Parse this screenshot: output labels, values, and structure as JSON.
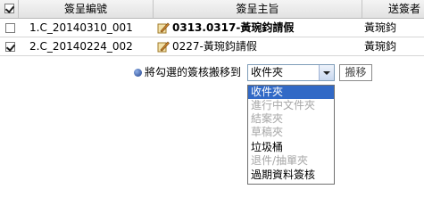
{
  "table": {
    "headers": {
      "id": "簽呈編號",
      "subject": "簽呈主旨",
      "sender": "送簽者"
    },
    "rows": [
      {
        "checked": false,
        "id": "1.C_20140310_001",
        "subject": "0313.0317-黃琬鈞請假",
        "sender": "黃琬鈞"
      },
      {
        "checked": true,
        "id": "2.C_20140224_002",
        "subject": "0227-黃琬鈞請假",
        "sender": "黃琬鈞"
      }
    ]
  },
  "move": {
    "label": "將勾選的簽核搬移到",
    "selected": "收件夾",
    "button": "搬移",
    "options": [
      {
        "label": "收件夾",
        "state": "selected"
      },
      {
        "label": "進行中文件夾",
        "state": "disabled"
      },
      {
        "label": "結案夾",
        "state": "disabled"
      },
      {
        "label": "草稿夾",
        "state": "disabled"
      },
      {
        "label": "垃圾桶",
        "state": "enabled"
      },
      {
        "label": "退件/抽單夾",
        "state": "disabled"
      },
      {
        "label": "過期資料簽核",
        "state": "enabled"
      }
    ]
  },
  "colors": {
    "selection": "#3169c6",
    "disabled_text": "#a6a6a6"
  }
}
